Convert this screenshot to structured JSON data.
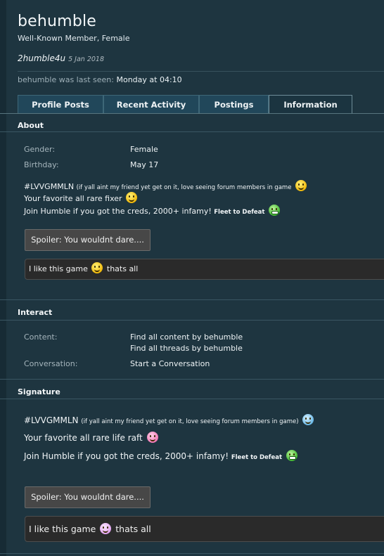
{
  "profile": {
    "username": "behumble",
    "subtitle": "Well-Known Member, Female",
    "status_text": "2humble4u",
    "status_date": "5 Jan 2018",
    "last_seen_label": "behumble was last seen:",
    "last_seen_value": "Monday at 04:10"
  },
  "tabs": [
    {
      "label": "Profile Posts"
    },
    {
      "label": "Recent Activity"
    },
    {
      "label": "Postings"
    },
    {
      "label": "Information",
      "active": true
    }
  ],
  "about": {
    "heading": "About",
    "gender_label": "Gender:",
    "gender_value": "Female",
    "birthday_label": "Birthday:",
    "birthday_value": "May 17",
    "bio_line1_main": "#LVVGMMLN",
    "bio_line1_small": "(if yall aint my friend yet get on it, love seeing forum members in game",
    "bio_line2": "Your favorite all rare fixer",
    "bio_line3_main": "Join Humble if you got the creds, 2000+ infamy!",
    "bio_line3_bold": "Fleet to Defeat",
    "spoiler_label": "Spoiler: You wouldnt dare....",
    "spoiler_text_before": "I like this game",
    "spoiler_text_after": "thats all"
  },
  "interact": {
    "heading": "Interact",
    "content_label": "Content:",
    "content_link1": "Find all content by behumble",
    "content_link2": "Find all threads by behumble",
    "conversation_label": "Conversation:",
    "conversation_link": "Start a Conversation"
  },
  "signature": {
    "heading": "Signature",
    "line1_main": "#LVVGMMLN",
    "line1_small": "(if yall aint my friend yet get on it, love seeing forum members in game)",
    "line2": "Your favorite all rare life raft",
    "line3_main": "Join Humble if you got the creds, 2000+ infamy!",
    "line3_bold": "Fleet to Defeat",
    "spoiler_label": "Spoiler: You wouldnt dare....",
    "spoiler_text_before": "I like this game",
    "spoiler_text_after": "thats all"
  },
  "icons": {
    "about_line1": "grin-smiley-icon",
    "about_line2": "grin-smiley-icon",
    "about_line3": "green-grin-smiley-icon",
    "about_spoiler": "grin-smiley-icon",
    "sig_line1": "cool-smiley-icon",
    "sig_line2": "tongue-smiley-icon",
    "sig_line3": "green-grin-smiley-icon",
    "sig_spoiler": "shocked-smiley-icon"
  }
}
